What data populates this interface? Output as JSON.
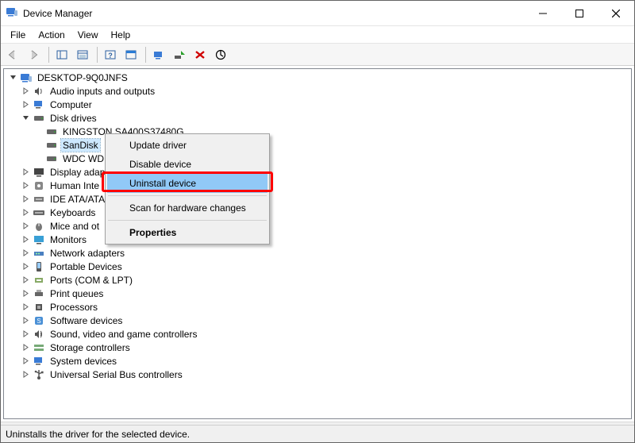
{
  "window": {
    "title": "Device Manager"
  },
  "menubar": [
    "File",
    "Action",
    "View",
    "Help"
  ],
  "toolbar_icons": [
    "back-icon",
    "forward-icon",
    "show-hide-tree-icon",
    "properties-icon",
    "help-icon",
    "action-pane-icon",
    "scan-hardware-icon",
    "add-legacy-icon",
    "uninstall-icon",
    "update-driver-icon"
  ],
  "computer_name": "DESKTOP-9Q0JNFS",
  "tree": [
    {
      "label": "Audio inputs and outputs",
      "icon": "speaker",
      "expanded": false
    },
    {
      "label": "Computer",
      "icon": "computer",
      "expanded": false
    },
    {
      "label": "Disk drives",
      "icon": "disk",
      "expanded": true,
      "children": [
        {
          "label": "KINGSTON SA400S37480G",
          "icon": "disk"
        },
        {
          "label": "SanDisk",
          "icon": "disk",
          "selected": true
        },
        {
          "label": "WDC WD",
          "icon": "disk"
        }
      ]
    },
    {
      "label": "Display adapters",
      "icon": "display",
      "expanded": false,
      "truncated": "Display adap"
    },
    {
      "label": "Human Interface Devices",
      "icon": "hid",
      "expanded": false,
      "truncated": "Human Inte"
    },
    {
      "label": "IDE ATA/ATAPI controllers",
      "icon": "ide",
      "expanded": false,
      "truncated": "IDE ATA/ATA"
    },
    {
      "label": "Keyboards",
      "icon": "keyboard",
      "expanded": false
    },
    {
      "label": "Mice and other pointing devices",
      "icon": "mouse",
      "expanded": false,
      "truncated": "Mice and ot"
    },
    {
      "label": "Monitors",
      "icon": "monitor",
      "expanded": false
    },
    {
      "label": "Network adapters",
      "icon": "network",
      "expanded": false
    },
    {
      "label": "Portable Devices",
      "icon": "portable",
      "expanded": false
    },
    {
      "label": "Ports (COM & LPT)",
      "icon": "port",
      "expanded": false
    },
    {
      "label": "Print queues",
      "icon": "printer",
      "expanded": false
    },
    {
      "label": "Processors",
      "icon": "cpu",
      "expanded": false
    },
    {
      "label": "Software devices",
      "icon": "software",
      "expanded": false
    },
    {
      "label": "Sound, video and game controllers",
      "icon": "sound",
      "expanded": false
    },
    {
      "label": "Storage controllers",
      "icon": "storage",
      "expanded": false
    },
    {
      "label": "System devices",
      "icon": "system",
      "expanded": false
    },
    {
      "label": "Universal Serial Bus controllers",
      "icon": "usb",
      "expanded": false
    }
  ],
  "context_menu": {
    "items": [
      {
        "label": "Update driver"
      },
      {
        "label": "Disable device"
      },
      {
        "label": "Uninstall device",
        "highlighted": true,
        "red_box": true
      },
      {
        "sep": true
      },
      {
        "label": "Scan for hardware changes"
      },
      {
        "sep": true
      },
      {
        "label": "Properties",
        "bold": true
      }
    ]
  },
  "statusbar": "Uninstalls the driver for the selected device."
}
